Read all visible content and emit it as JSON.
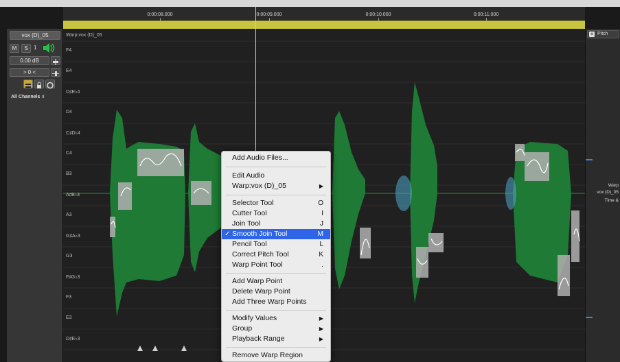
{
  "track": {
    "name": "vox (D)_05",
    "mute_label": "M",
    "solo_label": "S",
    "track_number": "1",
    "volume": "0.00 dB",
    "pan": "> 0 <",
    "channels": "All Channels"
  },
  "ruler": {
    "ticks": [
      "0:00:08.000",
      "0:00:09.000",
      "0:00:10.000",
      "0:00:11.000"
    ]
  },
  "editor": {
    "warp_label": "Warp:vox (D)_05",
    "note_labels": [
      "F4",
      "E4",
      "D♯E♭4",
      "D4",
      "C♯D♭4",
      "C4",
      "B3",
      "A♯B♭3",
      "A3",
      "G♯A♭3",
      "G3",
      "F♯G♭3",
      "F3",
      "E3",
      "D♯E♭3"
    ]
  },
  "inspector": {
    "pitch_label": "Pitch",
    "warp_text_1": "Warp",
    "warp_text_2": "vox (D)_05",
    "warp_text_3": "Time &"
  },
  "context_menu": {
    "items": [
      {
        "label": "Add Audio Files...",
        "shortcut": ""
      },
      {
        "label": "Edit Audio",
        "shortcut": ""
      },
      {
        "label": "Warp:vox (D)_05",
        "shortcut": "",
        "submenu": true
      },
      {
        "label": "Selector Tool",
        "shortcut": "O"
      },
      {
        "label": "Cutter Tool",
        "shortcut": "I"
      },
      {
        "label": "Join Tool",
        "shortcut": "J"
      },
      {
        "label": "Smooth Join Tool",
        "shortcut": "M",
        "checked": true,
        "selected": true
      },
      {
        "label": "Pencil Tool",
        "shortcut": "L"
      },
      {
        "label": "Correct Pitch Tool",
        "shortcut": "K"
      },
      {
        "label": "Warp Point Tool",
        "shortcut": "."
      },
      {
        "label": "Add Warp Point",
        "shortcut": ""
      },
      {
        "label": "Delete Warp Point",
        "shortcut": ""
      },
      {
        "label": "Add Three Warp Points",
        "shortcut": ""
      },
      {
        "label": "Modify Values",
        "shortcut": "",
        "submenu": true
      },
      {
        "label": "Group",
        "shortcut": "",
        "submenu": true
      },
      {
        "label": "Playback Range",
        "shortcut": "",
        "submenu": true
      },
      {
        "label": "Remove Warp Region",
        "shortcut": ""
      }
    ]
  },
  "colors": {
    "waveform": "#1e7a35",
    "yellow_bar": "#c8c440",
    "menu_highlight": "#2d64e8",
    "speaker": "#25c24a"
  }
}
